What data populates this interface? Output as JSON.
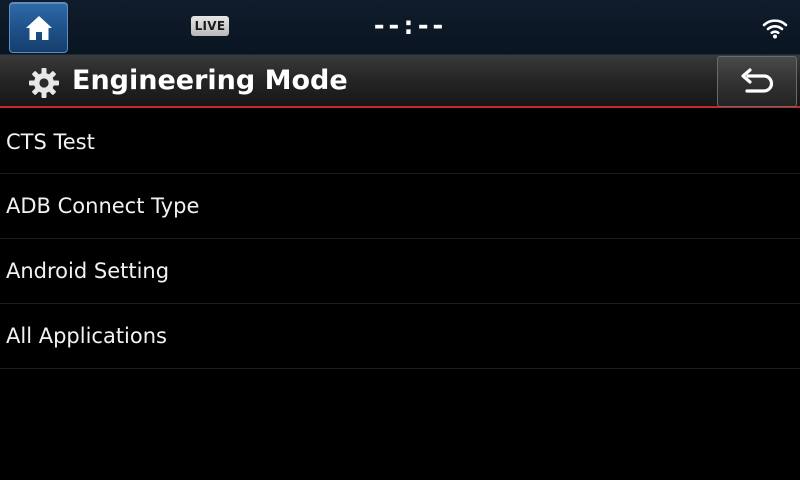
{
  "status_bar": {
    "live_badge": "LIVE",
    "clock": "--:--"
  },
  "header": {
    "title": "Engineering Mode"
  },
  "menu": {
    "items": [
      {
        "label": "CTS Test"
      },
      {
        "label": "ADB Connect Type"
      },
      {
        "label": "Android Setting"
      },
      {
        "label": "All Applications"
      }
    ]
  },
  "icons": {
    "home": "home-icon",
    "wifi": "wifi-icon",
    "settings": "gear-icon",
    "back": "back-arrow-icon"
  },
  "colors": {
    "status_bar_bg": "#0f1c2b",
    "home_button": "#2f6aa8",
    "header_accent": "#c2282c",
    "background": "#000000",
    "text": "#ffffff"
  }
}
